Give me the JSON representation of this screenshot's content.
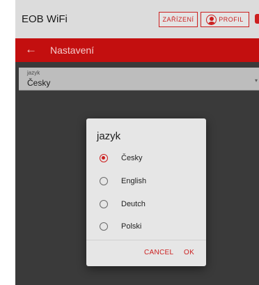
{
  "app": {
    "title": "EOB WiFi",
    "devices_label": "ZAŘÍZENÍ",
    "profile_label": "PROFIL"
  },
  "header": {
    "back_icon": "arrow-left-icon",
    "title": "Nastavení"
  },
  "field": {
    "label": "jazyk",
    "value": "Česky"
  },
  "dialog": {
    "title": "jazyk",
    "options": [
      {
        "label": "Česky",
        "selected": true
      },
      {
        "label": "English",
        "selected": false
      },
      {
        "label": "Deutch",
        "selected": false
      },
      {
        "label": "Polski",
        "selected": false
      }
    ],
    "cancel_label": "CANCEL",
    "ok_label": "OK"
  },
  "colors": {
    "accent": "#cc1f1f",
    "header_bg": "#c30f0f",
    "topbar_bg": "#dcdcdc",
    "backdrop": "#3a3a3a",
    "dialog_bg": "#e6e6e6"
  }
}
